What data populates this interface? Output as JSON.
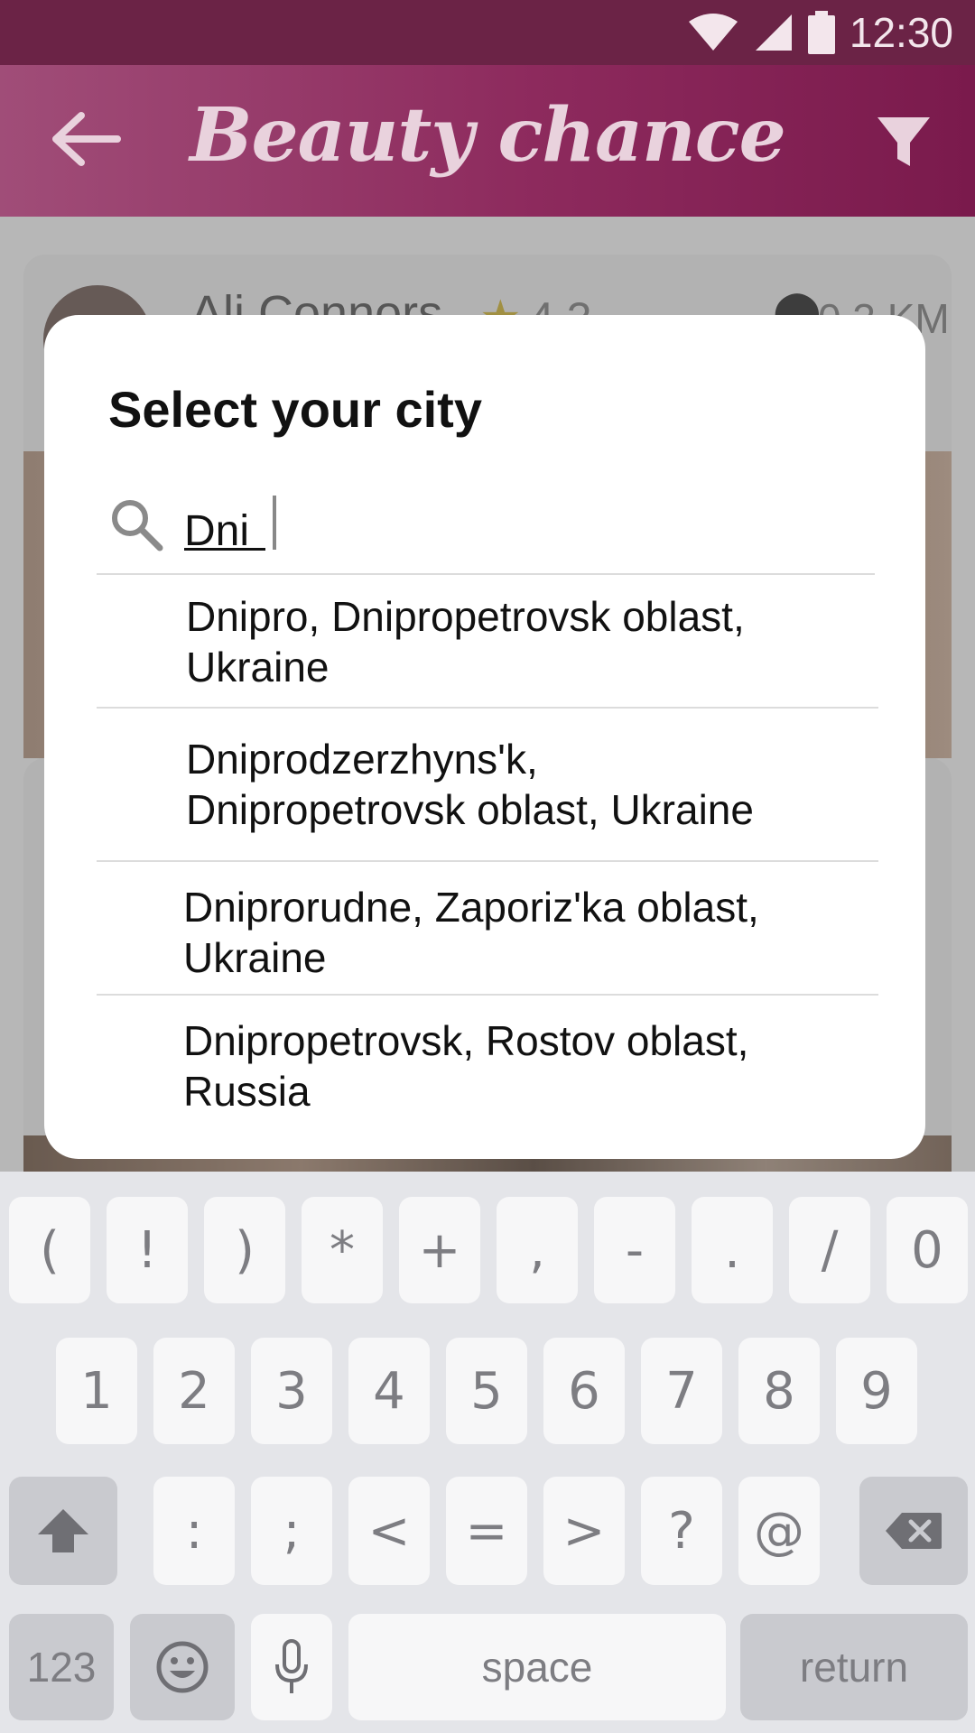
{
  "status_bar": {
    "time": "12:30",
    "icons": [
      "wifi-icon",
      "signal-icon",
      "battery-icon"
    ]
  },
  "app_bar": {
    "title": "Beauty chance",
    "back_icon": "back-arrow-icon",
    "filter_icon": "filter-icon"
  },
  "background_card": {
    "name": "Ali Connors",
    "rating": "4.3",
    "distance": "0.3 KM"
  },
  "dialog": {
    "title": "Select your city",
    "search": {
      "value": "Dni",
      "icon": "search-icon"
    },
    "results": [
      {
        "line1": "Dnipro, Dnipropetrovsk oblast,",
        "line2": "Ukraine"
      },
      {
        "line1": "Dniprodzerzhyns'k,",
        "line2": "Dnipropetrovsk oblast, Ukraine"
      },
      {
        "line1": "Dniprorudne, Zaporiz'ka oblast,",
        "line2": "Ukraine"
      },
      {
        "line1": "Dnipropetrovsk, Rostov oblast,",
        "line2": "Russia"
      }
    ]
  },
  "keyboard": {
    "row1": [
      "(",
      "!",
      ")",
      "*",
      "+",
      ",",
      "-",
      ".",
      "/",
      "0"
    ],
    "row2": [
      "1",
      "2",
      "3",
      "4",
      "5",
      "6",
      "7",
      "8",
      "9"
    ],
    "row3": [
      ":",
      ";",
      "<",
      "=",
      ">",
      "?",
      "@"
    ],
    "mode_key": "123",
    "space_key": "space",
    "return_key": "return",
    "icons": [
      "shift-icon",
      "backspace-icon",
      "emoji-icon",
      "microphone-icon"
    ]
  }
}
